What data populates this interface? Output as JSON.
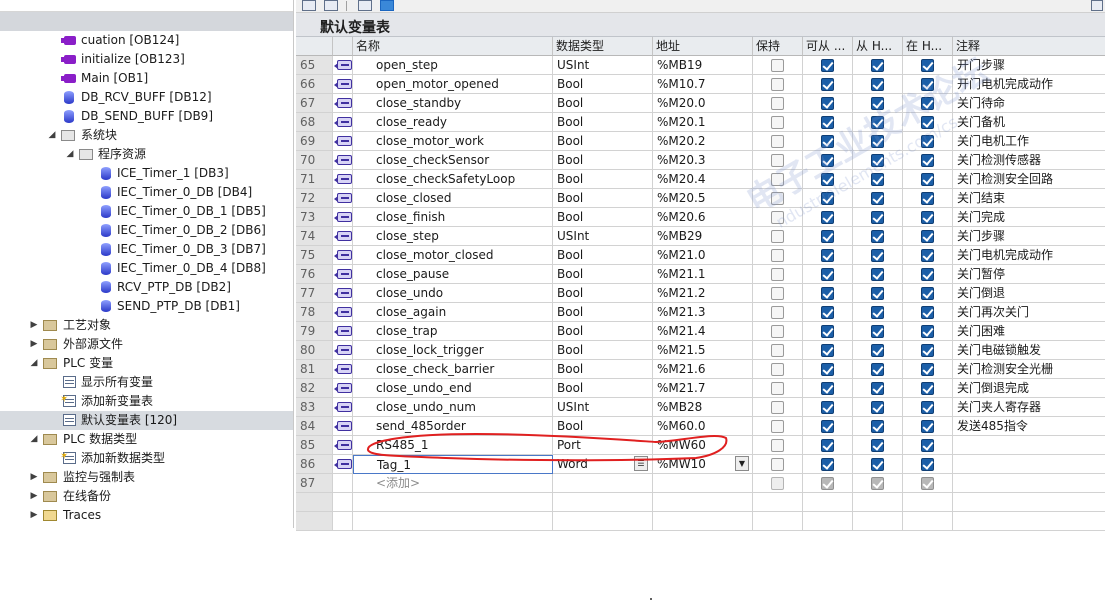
{
  "tree": {
    "items": [
      {
        "label": "cuation [OB124]",
        "icon": "ob-icon"
      },
      {
        "label": "initialize [OB123]",
        "icon": "ob-icon"
      },
      {
        "label": "Main [OB1]",
        "icon": "ob-icon"
      },
      {
        "label": "DB_RCV_BUFF [DB12]",
        "icon": "db-icon"
      },
      {
        "label": "DB_SEND_BUFF [DB9]",
        "icon": "db-icon"
      },
      {
        "label": "系统块",
        "icon": "folder-icon"
      },
      {
        "label": "程序资源",
        "icon": "folder-icon"
      },
      {
        "label": "ICE_Timer_1 [DB3]",
        "icon": "db-icon"
      },
      {
        "label": "IEC_Timer_0_DB [DB4]",
        "icon": "db-icon"
      },
      {
        "label": "IEC_Timer_0_DB_1 [DB5]",
        "icon": "db-icon"
      },
      {
        "label": "IEC_Timer_0_DB_2 [DB6]",
        "icon": "db-icon"
      },
      {
        "label": "IEC_Timer_0_DB_3 [DB7]",
        "icon": "db-icon"
      },
      {
        "label": "IEC_Timer_0_DB_4 [DB8]",
        "icon": "db-icon"
      },
      {
        "label": "RCV_PTP_DB [DB2]",
        "icon": "db-icon"
      },
      {
        "label": "SEND_PTP_DB [DB1]",
        "icon": "db-icon"
      },
      {
        "label": "工艺对象",
        "icon": "folder-icon"
      },
      {
        "label": "外部源文件",
        "icon": "folder-icon"
      },
      {
        "label": "PLC 变量",
        "icon": "folder-icon"
      },
      {
        "label": "显示所有变量",
        "icon": "table-icon"
      },
      {
        "label": "添加新变量表",
        "icon": "add-icon"
      },
      {
        "label": "默认变量表 [120]",
        "icon": "table-icon"
      },
      {
        "label": "PLC 数据类型",
        "icon": "folder-icon"
      },
      {
        "label": "添加新数据类型",
        "icon": "add-icon"
      },
      {
        "label": "监控与强制表",
        "icon": "folder-icon"
      },
      {
        "label": "在线备份",
        "icon": "folder-icon"
      },
      {
        "label": "Traces",
        "icon": "folder-icon"
      }
    ]
  },
  "editor": {
    "title": "默认变量表",
    "columns": {
      "name": "名称",
      "type": "数据类型",
      "address": "地址",
      "retain": "保持",
      "access": "可从 ...",
      "from_hmi": "从 H...",
      "in_hmi": "在 H...",
      "comment": "注释"
    },
    "rows": [
      {
        "num": "65",
        "name": "open_step",
        "type": "USInt",
        "address": "%MB19",
        "comment": "开门步骤"
      },
      {
        "num": "66",
        "name": "open_motor_opened",
        "type": "Bool",
        "address": "%M10.7",
        "comment": "开门电机完成动作"
      },
      {
        "num": "67",
        "name": "close_standby",
        "type": "Bool",
        "address": "%M20.0",
        "comment": "关门待命"
      },
      {
        "num": "68",
        "name": "close_ready",
        "type": "Bool",
        "address": "%M20.1",
        "comment": "关门备机"
      },
      {
        "num": "69",
        "name": "close_motor_work",
        "type": "Bool",
        "address": "%M20.2",
        "comment": "关门电机工作"
      },
      {
        "num": "70",
        "name": "close_checkSensor",
        "type": "Bool",
        "address": "%M20.3",
        "comment": "关门检测传感器"
      },
      {
        "num": "71",
        "name": "close_checkSafetyLoop",
        "type": "Bool",
        "address": "%M20.4",
        "comment": "关门检测安全回路"
      },
      {
        "num": "72",
        "name": "close_closed",
        "type": "Bool",
        "address": "%M20.5",
        "comment": "关门结束"
      },
      {
        "num": "73",
        "name": "close_finish",
        "type": "Bool",
        "address": "%M20.6",
        "comment": "关门完成"
      },
      {
        "num": "74",
        "name": "close_step",
        "type": "USInt",
        "address": "%MB29",
        "comment": "关门步骤"
      },
      {
        "num": "75",
        "name": "close_motor_closed",
        "type": "Bool",
        "address": "%M21.0",
        "comment": "关门电机完成动作"
      },
      {
        "num": "76",
        "name": "close_pause",
        "type": "Bool",
        "address": "%M21.1",
        "comment": "关门暂停"
      },
      {
        "num": "77",
        "name": "close_undo",
        "type": "Bool",
        "address": "%M21.2",
        "comment": "关门倒退"
      },
      {
        "num": "78",
        "name": "close_again",
        "type": "Bool",
        "address": "%M21.3",
        "comment": "关门再次关门"
      },
      {
        "num": "79",
        "name": "close_trap",
        "type": "Bool",
        "address": "%M21.4",
        "comment": "关门困难"
      },
      {
        "num": "80",
        "name": "close_lock_trigger",
        "type": "Bool",
        "address": "%M21.5",
        "comment": "关门电磁锁触发"
      },
      {
        "num": "81",
        "name": "close_check_barrier",
        "type": "Bool",
        "address": "%M21.6",
        "comment": "关门检测安全光栅"
      },
      {
        "num": "82",
        "name": "close_undo_end",
        "type": "Bool",
        "address": "%M21.7",
        "comment": "关门倒退完成"
      },
      {
        "num": "83",
        "name": "close_undo_num",
        "type": "USInt",
        "address": "%MB28",
        "comment": "关门夹人寄存器"
      },
      {
        "num": "84",
        "name": "send_485order",
        "type": "Bool",
        "address": "%M60.0",
        "comment": "发送485指令"
      },
      {
        "num": "85",
        "name": "RS485_1",
        "type": "Port",
        "address": "%MW60",
        "comment": ""
      },
      {
        "num": "86",
        "name": "Tag_1",
        "type": "Word",
        "address": "%MW10",
        "comment": ""
      }
    ],
    "add_row": {
      "num": "87",
      "placeholder": "<添加>"
    }
  },
  "watermark": {
    "main": "电子工业技术论坛",
    "sub": "ndustrialelements.com/cs"
  },
  "colors": {
    "checked": "#1c5fa8",
    "annotation": "#e02020",
    "selected_row": "#d7dbe0"
  }
}
